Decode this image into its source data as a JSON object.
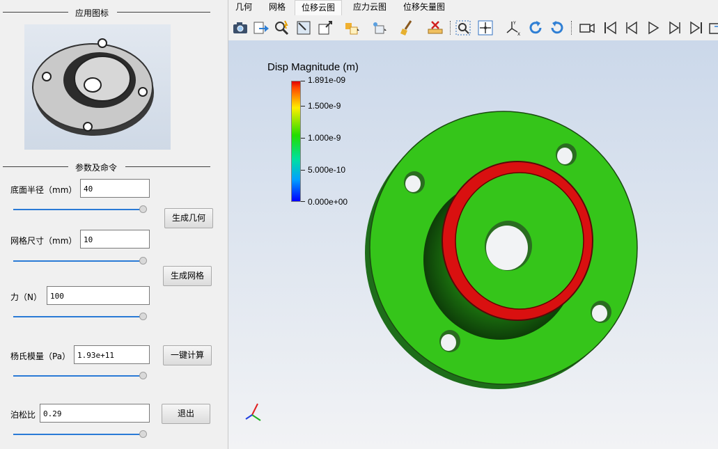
{
  "left_panel": {
    "icon_group_title": "应用图标",
    "params_group_title": "参数及命令",
    "fields": [
      {
        "label": "底面半径（mm）",
        "value": "40"
      },
      {
        "label": "网格尺寸（mm）",
        "value": "10"
      },
      {
        "label": "力（N）",
        "value": "100"
      },
      {
        "label": "杨氏模量（Pa）",
        "value": "1.93e+11"
      },
      {
        "label": "泊松比",
        "value": "0.29"
      }
    ],
    "buttons": {
      "generate_geometry": "生成几何",
      "generate_mesh": "生成网格",
      "compute": "一键计算",
      "exit": "退出"
    },
    "sliders": [
      1.0,
      1.0,
      1.0,
      1.0,
      1.0
    ]
  },
  "tabs": [
    {
      "label": "几何",
      "active": false
    },
    {
      "label": "网格",
      "active": false
    },
    {
      "label": "位移云图",
      "active": true
    },
    {
      "label": "应力云图",
      "active": false
    },
    {
      "label": "位移矢量图",
      "active": false
    }
  ],
  "toolbar_icons": [
    "camera-icon",
    "export-icon",
    "magnifier-select-icon",
    "zoom-box-icon",
    "reset-camera-icon",
    "select-cells-icon",
    "select-points-icon",
    "clear-brush-icon",
    "clear-selection-icon",
    "zoom-to-selection-icon",
    "center-icon",
    "axes-icon",
    "rotate-cw-icon",
    "rotate-ccw-icon",
    "record-icon",
    "first-frame-icon",
    "prev-frame-icon",
    "play-icon",
    "next-frame-icon",
    "last-frame-icon",
    "loop-icon"
  ],
  "viewport": {
    "legend_title": "Disp Magnitude (m)",
    "legend_ticks": [
      "1.891e-09",
      "1.500e-9",
      "1.000e-9",
      "5.000e-10",
      "0.000e+00"
    ],
    "colors": {
      "high": "#dd0000",
      "mid": "#22dd00",
      "low": "#0000ff",
      "background_top": "#cbd8ea"
    }
  }
}
